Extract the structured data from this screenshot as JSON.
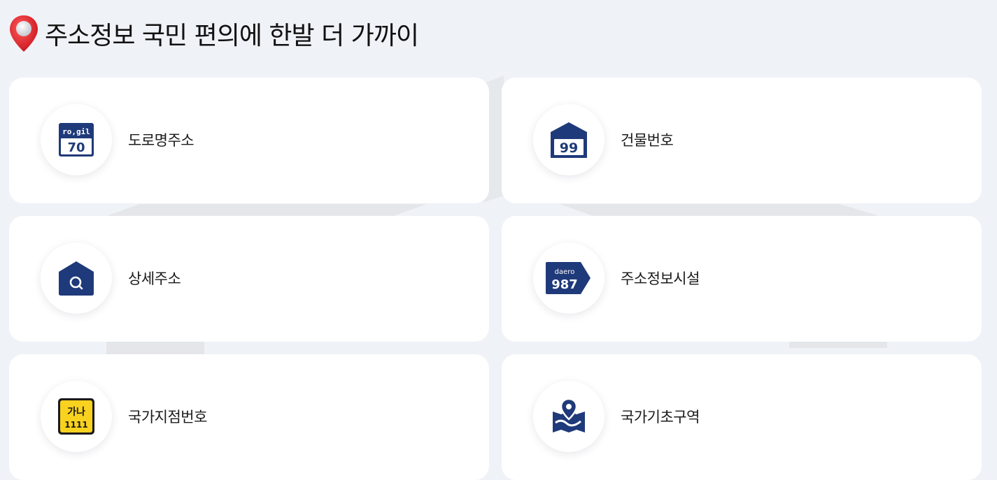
{
  "header": {
    "title": "주소정보 국민 편의에 한발 더 가까이",
    "pin_icon": "location-pin-icon"
  },
  "colors": {
    "background": "#eff2f7",
    "card": "#ffffff",
    "navy": "#1f3a7a",
    "yellow": "#f9d21f",
    "pin_red": "#e8202a"
  },
  "cards": [
    {
      "label": "도로명주소",
      "icon": "road-name-sign-icon",
      "sign_top": "ro,gil",
      "sign_num": "70"
    },
    {
      "label": "건물번호",
      "icon": "building-number-plate-icon",
      "sign_num": "99"
    },
    {
      "label": "상세주소",
      "icon": "house-search-icon"
    },
    {
      "label": "주소정보시설",
      "icon": "road-sign-arrow-icon",
      "sign_top": "daero",
      "sign_num": "987"
    },
    {
      "label": "국가지점번호",
      "icon": "national-point-plate-icon",
      "sign_top": "가나",
      "sign_num": "1111"
    },
    {
      "label": "국가기초구역",
      "icon": "map-pin-icon"
    }
  ]
}
